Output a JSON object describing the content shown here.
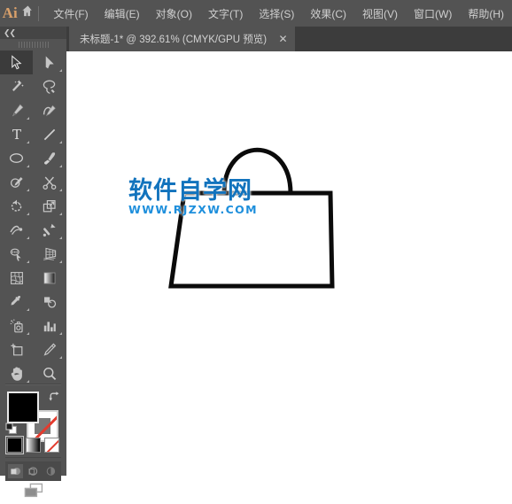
{
  "app": {
    "logo_text": "Ai",
    "logo_color": "#d9a06a",
    "home_icon": "home-icon"
  },
  "menubar": {
    "background": "#535353",
    "text_color": "#cfcfcf",
    "items": [
      {
        "label": "文件(F)"
      },
      {
        "label": "编辑(E)"
      },
      {
        "label": "对象(O)"
      },
      {
        "label": "文字(T)"
      },
      {
        "label": "选择(S)"
      },
      {
        "label": "效果(C)"
      },
      {
        "label": "视图(V)"
      },
      {
        "label": "窗口(W)"
      },
      {
        "label": "帮助(H)"
      }
    ]
  },
  "tabbar": {
    "background": "#3c3c3c",
    "document": {
      "title": "未标题-1* @ 392.61% (CMYK/GPU 预览)",
      "close_label": "✕",
      "zoom_level": "392.61%",
      "color_mode": "CMYK",
      "preview_mode": "GPU 预览",
      "modified": true
    }
  },
  "toolbar": {
    "background": "#535353",
    "collapse_label": "❮❮",
    "tools": [
      {
        "name": "selection-tool",
        "label": "选择工具",
        "active": true,
        "has_flyout": false
      },
      {
        "name": "direct-selection-tool",
        "label": "直接选择工具",
        "active": false,
        "has_flyout": true
      },
      {
        "name": "magic-wand-tool",
        "label": "魔棒工具",
        "active": false,
        "has_flyout": false
      },
      {
        "name": "lasso-tool",
        "label": "套索工具",
        "active": false,
        "has_flyout": false
      },
      {
        "name": "pen-tool",
        "label": "钢笔工具",
        "active": false,
        "has_flyout": true
      },
      {
        "name": "curvature-tool",
        "label": "曲率工具",
        "active": false,
        "has_flyout": false
      },
      {
        "name": "type-tool",
        "label": "文字工具",
        "active": false,
        "has_flyout": true
      },
      {
        "name": "line-segment-tool",
        "label": "直线段工具",
        "active": false,
        "has_flyout": true
      },
      {
        "name": "ellipse-tool",
        "label": "椭圆工具",
        "active": false,
        "has_flyout": true
      },
      {
        "name": "paintbrush-tool",
        "label": "画笔工具",
        "active": false,
        "has_flyout": true
      },
      {
        "name": "shaper-tool",
        "label": "Shaper 工具",
        "active": false,
        "has_flyout": true
      },
      {
        "name": "scissors-tool",
        "label": "剪刀工具",
        "active": false,
        "has_flyout": true
      },
      {
        "name": "rotate-tool",
        "label": "旋转工具",
        "active": false,
        "has_flyout": true
      },
      {
        "name": "scale-tool",
        "label": "比例缩放工具",
        "active": false,
        "has_flyout": true
      },
      {
        "name": "width-tool",
        "label": "宽度工具",
        "active": false,
        "has_flyout": true
      },
      {
        "name": "free-transform-tool",
        "label": "自由变换工具",
        "active": false,
        "has_flyout": true
      },
      {
        "name": "shape-builder-tool",
        "label": "形状生成器工具",
        "active": false,
        "has_flyout": true
      },
      {
        "name": "perspective-grid-tool",
        "label": "透视网格工具",
        "active": false,
        "has_flyout": true
      },
      {
        "name": "mesh-tool",
        "label": "网格工具",
        "active": false,
        "has_flyout": false
      },
      {
        "name": "gradient-tool",
        "label": "渐变工具",
        "active": false,
        "has_flyout": false
      },
      {
        "name": "eyedropper-tool",
        "label": "吸管工具",
        "active": false,
        "has_flyout": true
      },
      {
        "name": "blend-tool",
        "label": "混合工具",
        "active": false,
        "has_flyout": false
      },
      {
        "name": "symbol-sprayer-tool",
        "label": "符号喷枪工具",
        "active": false,
        "has_flyout": true
      },
      {
        "name": "column-graph-tool",
        "label": "柱形图工具",
        "active": false,
        "has_flyout": true
      },
      {
        "name": "artboard-tool",
        "label": "画板工具",
        "active": false,
        "has_flyout": false
      },
      {
        "name": "slice-tool",
        "label": "切片工具",
        "active": false,
        "has_flyout": true
      },
      {
        "name": "hand-tool",
        "label": "抓手工具",
        "active": false,
        "has_flyout": true
      },
      {
        "name": "zoom-tool",
        "label": "缩放工具",
        "active": false,
        "has_flyout": false
      }
    ],
    "color_controls": {
      "fill_color": "#000000",
      "fill_label": "填色",
      "stroke_color": "#ffffff",
      "stroke_label": "描边",
      "stroke_is_none": true,
      "swap_label": "互换填色和描边",
      "default_label": "默认填色和描边"
    },
    "color_modes": [
      {
        "name": "color-mode-solid",
        "label": "颜色",
        "selected": true
      },
      {
        "name": "color-mode-gradient",
        "label": "渐变",
        "selected": false
      },
      {
        "name": "color-mode-none",
        "label": "无",
        "selected": false
      }
    ],
    "draw_modes": [
      {
        "name": "draw-normal",
        "label": "正常绘图",
        "selected": true
      },
      {
        "name": "draw-behind",
        "label": "背面绘图",
        "selected": false
      },
      {
        "name": "draw-inside",
        "label": "内部绘图",
        "selected": false
      }
    ],
    "screen_mode": {
      "name": "change-screen-mode",
      "label": "更改屏幕模式"
    }
  },
  "canvas": {
    "background": "#ffffff",
    "artwork_name": "shopping-bag-outline",
    "stroke_color": "#000000",
    "stroke_width": "5",
    "fill": "none",
    "watermark": {
      "chinese": "软件自学网",
      "url": "WWW.RJZXW.COM",
      "color_cn": "#1273bd",
      "color_en": "#1e8fdc"
    }
  }
}
